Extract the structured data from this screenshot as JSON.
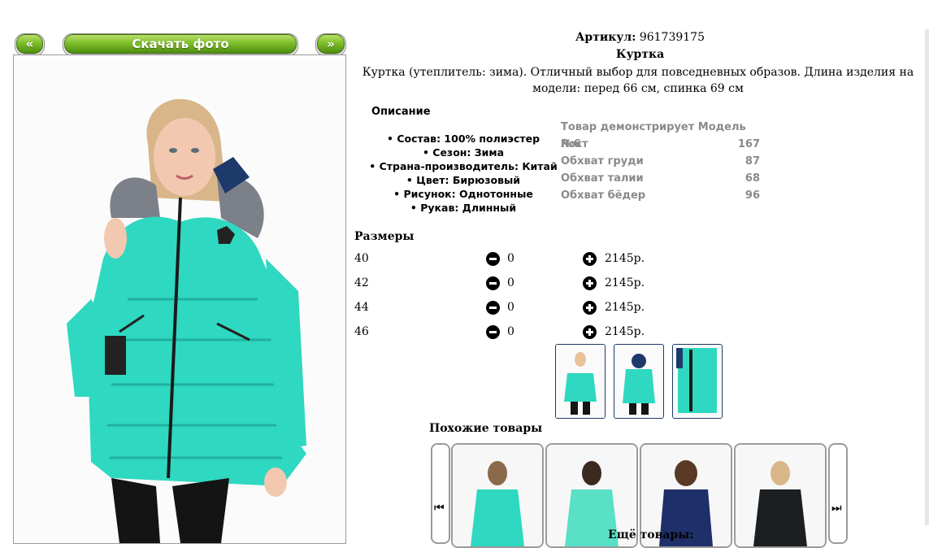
{
  "nav": {
    "prev_label": "«",
    "download_label": "Скачать фото",
    "next_label": "»"
  },
  "product": {
    "article_label": "Артикул:",
    "article_value": "961739175",
    "name": "Куртка",
    "description": "Куртка (утеплитель: зима). Отличный выбор для повседневных образов. Длина изделия на модели: перед 66 см, спинка 69 см"
  },
  "details": {
    "title": "Описание",
    "items": [
      "Состав: 100% полиэстер",
      "Сезон: Зима",
      "Страна-производитель: Китай",
      "Цвет: Бирюзовый",
      "Рисунок: Однотонные",
      "Рукав: Длинный"
    ]
  },
  "model": {
    "title": "Товар демонстрирует Модель №6",
    "rows": [
      {
        "label": "Рост",
        "value": "167"
      },
      {
        "label": "Обхват груди",
        "value": "87"
      },
      {
        "label": "Обхват талии",
        "value": "68"
      },
      {
        "label": "Обхват бёдер",
        "value": "96"
      }
    ]
  },
  "sizes": {
    "title": "Размеры",
    "rows": [
      {
        "size": "40",
        "qty": "0",
        "price": "2145р."
      },
      {
        "size": "42",
        "qty": "0",
        "price": "2145р."
      },
      {
        "size": "44",
        "qty": "0",
        "price": "2145р."
      },
      {
        "size": "46",
        "qty": "0",
        "price": "2145р."
      }
    ]
  },
  "similar": {
    "title": "Похожие товары",
    "more_label": "Ещё товары:"
  },
  "colors": {
    "jacket": "#2fd8c0",
    "nav_green": "#6fae22",
    "thumb_border": "#1f3a66"
  }
}
